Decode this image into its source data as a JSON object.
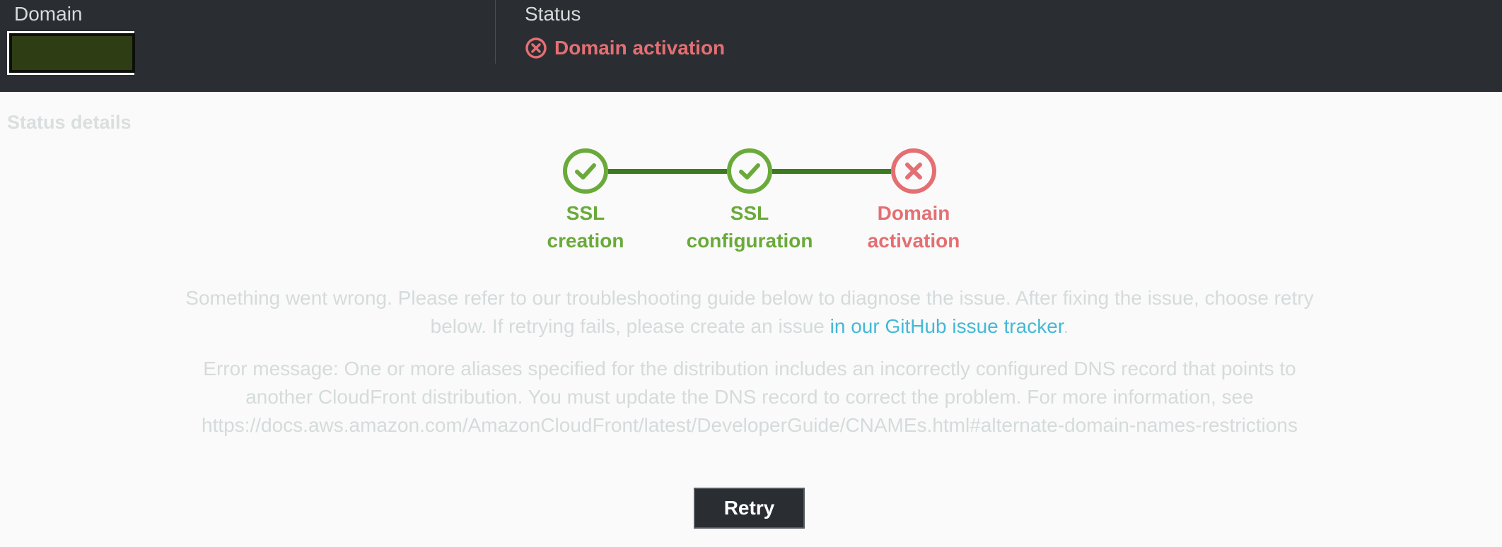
{
  "header": {
    "domain_label": "Domain",
    "status_label": "Status",
    "status_value": "Domain activation",
    "status_icon": "error-circle-icon",
    "status_color": "#e46f72"
  },
  "details": {
    "title": "Status details"
  },
  "steps": [
    {
      "line1": "SSL",
      "line2": "creation",
      "state": "complete",
      "icon": "check-circle-icon"
    },
    {
      "line1": "SSL",
      "line2": "configuration",
      "state": "complete",
      "icon": "check-circle-icon"
    },
    {
      "line1": "Domain",
      "line2": "activation",
      "state": "failed",
      "icon": "x-circle-icon"
    }
  ],
  "messages": {
    "troubleshoot_text": "Something went wrong. Please refer to our troubleshooting guide below to diagnose the issue. After fixing the issue, choose retry below. If retrying fails, please create an issue ",
    "github_link_text": "in our GitHub issue tracker",
    "troubleshoot_end": ".",
    "error_message": "Error message: One or more aliases specified for the distribution includes an incorrectly configured DNS record that points to another CloudFront distribution. You must update the DNS record to correct the problem. For more information, see https://docs.aws.amazon.com/AmazonCloudFront/latest/DeveloperGuide/CNAMEs.html#alternate-domain-names-restrictions"
  },
  "actions": {
    "retry_label": "Retry"
  },
  "colors": {
    "success": "#6aaa3a",
    "error": "#e46f72",
    "link": "#44b9d6",
    "header_bg": "#2a2e33"
  }
}
